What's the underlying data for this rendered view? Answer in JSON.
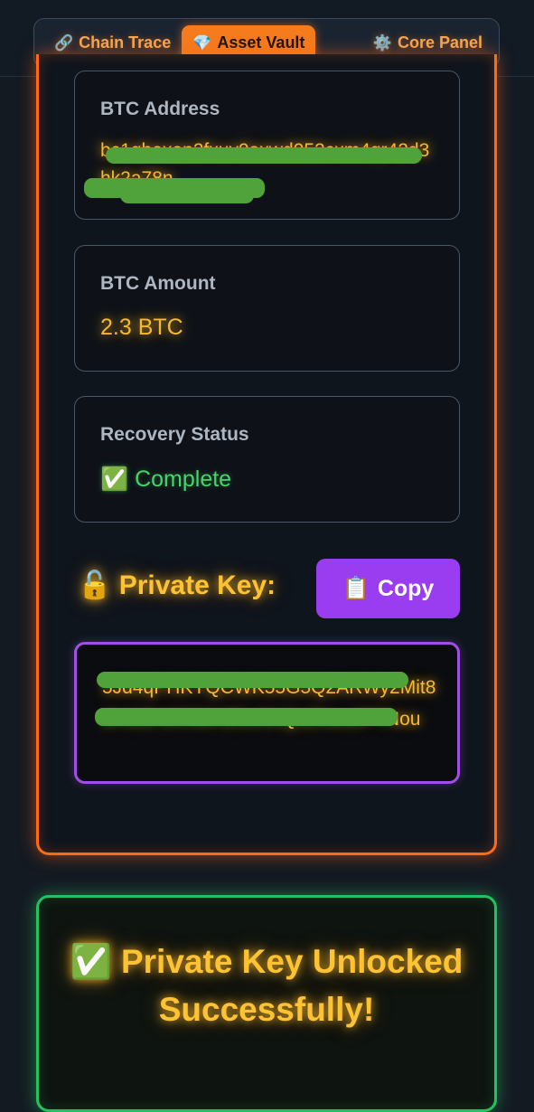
{
  "nav": {
    "tabs": [
      {
        "icon": "🔗",
        "icon_name": "link-icon",
        "label": "Chain Trace",
        "active": false
      },
      {
        "icon": "💎",
        "icon_name": "gem-icon",
        "label": "Asset Vault",
        "active": true
      },
      {
        "icon": "⚙️",
        "icon_name": "gear-icon",
        "label": "Core Panel",
        "active": false
      }
    ]
  },
  "vault": {
    "btc_address": {
      "label": "BTC Address",
      "value": "bc1qhexen2fxuv9axwd052cxm4qr42d3hk2a78n"
    },
    "btc_amount": {
      "label": "BTC Amount",
      "value": "2.3 BTC"
    },
    "recovery_status": {
      "label": "Recovery Status",
      "icon": "✅",
      "value": "Complete"
    },
    "private_key": {
      "icon": "🔓",
      "label": "Private Key:",
      "copy_icon": "📋",
      "copy_label": "Copy",
      "value": "5Jd4qPHKYQCWK55G5Q2ARWy2Mit8dVzMHJCN6XZ5cGhQoZNuu87TNou"
    }
  },
  "success": {
    "icon": "✅",
    "message": "Private Key Unlocked Successfully!"
  },
  "colors": {
    "accent_orange": "#ff6a12",
    "accent_green": "#23c25f",
    "accent_purple": "#9a3cf0",
    "value_gold": "#f5b82e",
    "status_green": "#49d36b"
  }
}
